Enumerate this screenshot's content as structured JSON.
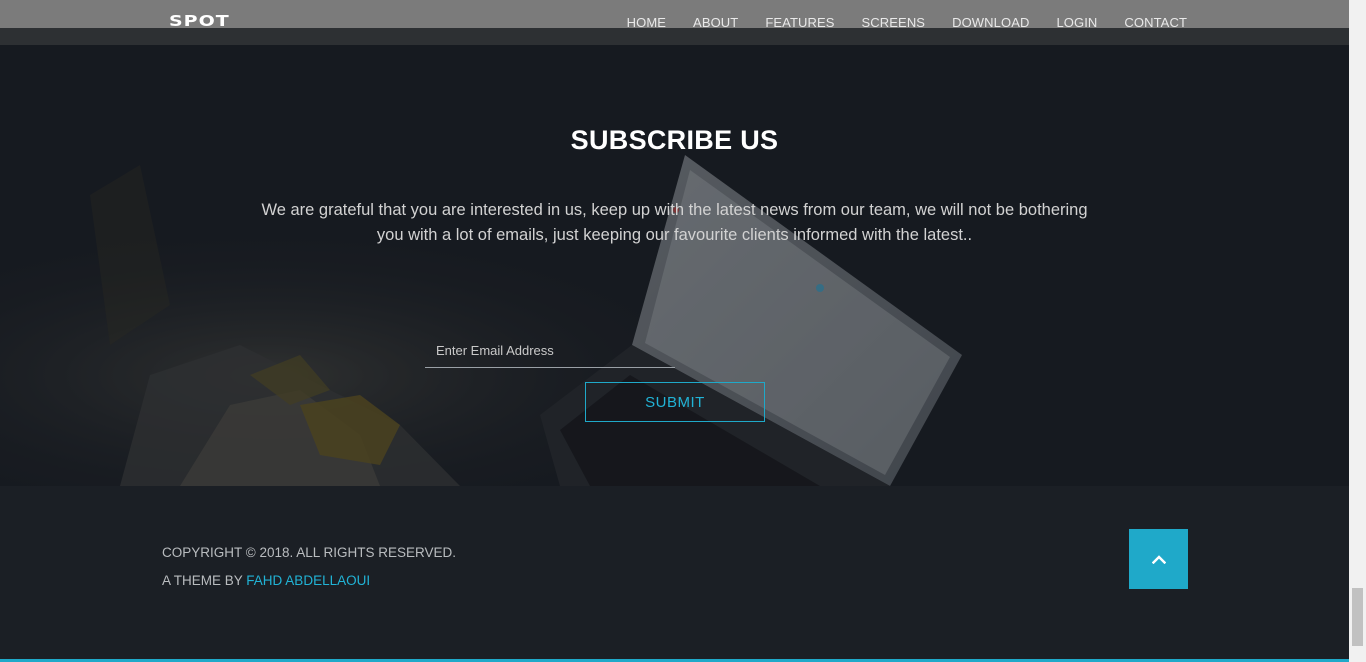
{
  "brand": {
    "logo": "SPOT"
  },
  "nav": {
    "items": [
      "HOME",
      "ABOUT",
      "FEATURES",
      "SCREENS",
      "DOWNLOAD",
      "LOGIN",
      "CONTACT"
    ]
  },
  "subscribe": {
    "title": "SUBSCRIBE US",
    "text": "We are grateful that you are interested in us, keep up with the latest news from our team, we will not be bothering you with a lot of emails, just keeping our favourite clients informed with the latest..",
    "email_placeholder": "Enter Email Address",
    "submit_label": "SUBMIT"
  },
  "footer": {
    "copyright": "COPYRIGHT © 2018. ALL RIGHTS RESERVED.",
    "credit_prefix": "A THEME BY ",
    "credit_author": "FAHD ABDELLAOUI",
    "to_top_icon": "chevron-up-icon"
  },
  "colors": {
    "accent": "#1fa9c9",
    "footer_bg": "#1b1f25",
    "nav_bg": "#7b7b7b"
  }
}
